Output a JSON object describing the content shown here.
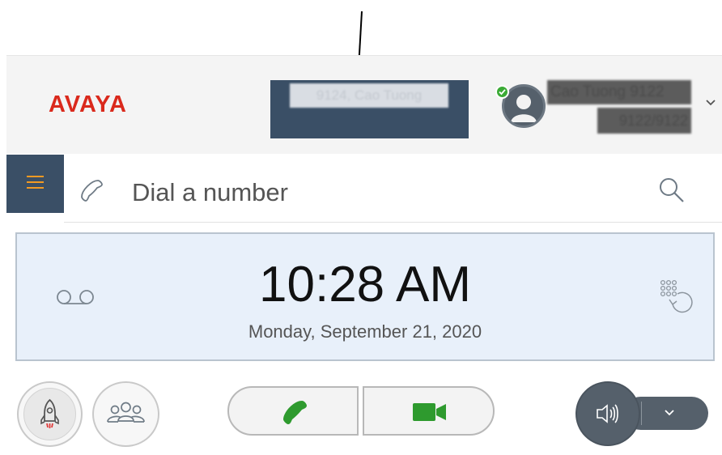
{
  "header": {
    "logo": "AVAYA",
    "line_label": "9124, Cao Tuong",
    "user": {
      "name": "Cao Tuong 9122",
      "extension": "9122/9122",
      "presence": "available"
    }
  },
  "dial": {
    "placeholder": "Dial a number"
  },
  "clock": {
    "time": "10:28 AM",
    "date": "Monday, September 21, 2020"
  },
  "icons": {
    "menu": "menu-icon",
    "phone": "phone-icon",
    "search": "search-icon",
    "voicemail": "voicemail-icon",
    "redial": "redial-icon",
    "launch": "rocket-icon",
    "contacts": "group-icon",
    "audio_call": "phone-icon",
    "video_call": "video-camera-icon",
    "speaker": "speaker-icon",
    "dropdown": "chevron-down-icon"
  },
  "colors": {
    "brand_red": "#da291c",
    "header_dark": "#3a4f66",
    "menu_accent": "#f39a22",
    "call_green": "#2e9a2e",
    "presence_green": "#3aaa35",
    "panel_bg": "#e8f0fa"
  }
}
